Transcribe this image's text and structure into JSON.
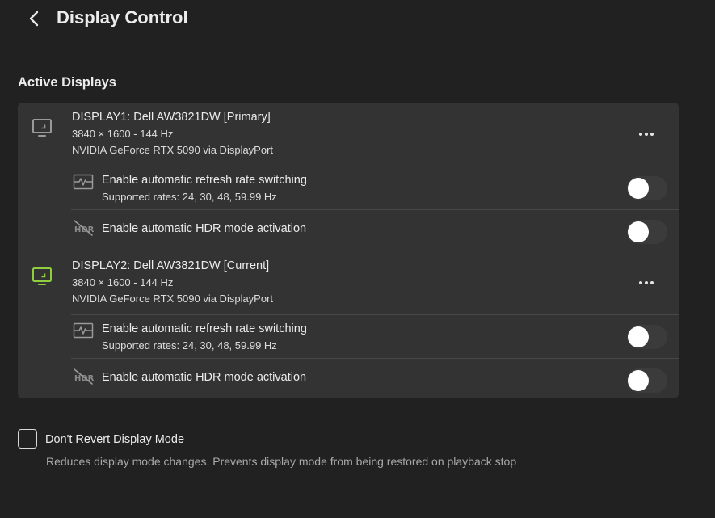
{
  "header": {
    "title": "Display Control",
    "back_icon": "chevron-left-icon"
  },
  "active_displays": {
    "title": "Active Displays",
    "displays": [
      {
        "name": "DISPLAY1: Dell AW3821DW [Primary]",
        "resolution": "3840 × 1600 - 144 Hz",
        "gpu": "NVIDIA GeForce RTX 5090 via DisplayPort",
        "icon_color": "#9a9a9a",
        "refresh_label": "Enable automatic refresh rate switching",
        "refresh_rates": "Supported rates: 24, 30, 48, 59.99 Hz",
        "refresh_enabled": false,
        "hdr_label": "Enable automatic HDR mode activation",
        "hdr_enabled": false
      },
      {
        "name": "DISPLAY2: Dell AW3821DW [Current]",
        "resolution": "3840 × 1600 - 144 Hz",
        "gpu": "NVIDIA GeForce RTX 5090 via DisplayPort",
        "icon_color": "#8fce3f",
        "refresh_label": "Enable automatic refresh rate switching",
        "refresh_rates": "Supported rates: 24, 30, 48, 59.99 Hz",
        "refresh_enabled": false,
        "hdr_label": "Enable automatic HDR mode activation",
        "hdr_enabled": false
      }
    ]
  },
  "dont_revert": {
    "label": "Don't Revert Display Mode",
    "description": "Reduces display mode changes. Prevents display mode from being restored on playback stop",
    "checked": false
  },
  "colors": {
    "background": "#212121",
    "card": "#333333",
    "current_display_accent": "#8fce3f"
  }
}
